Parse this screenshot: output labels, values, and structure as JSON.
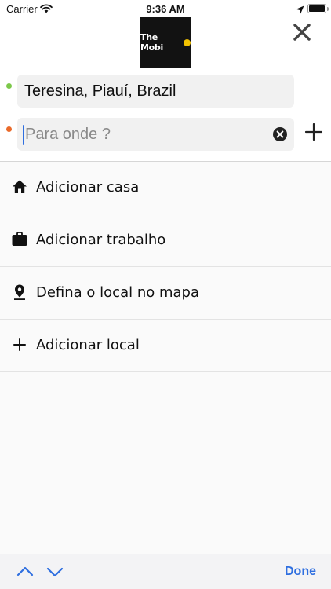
{
  "status_bar": {
    "carrier": "Carrier",
    "time": "9:36 AM",
    "battery_level": 1.0
  },
  "header": {
    "logo_text": "The Mobi"
  },
  "route": {
    "origin": "Teresina, Piauí, Brazil",
    "destination": {
      "value": "",
      "placeholder": "Para onde ?"
    },
    "start_color": "#7cc84a",
    "end_color": "#ea6a2a"
  },
  "places": [
    {
      "label": "Adicionar casa",
      "icon": "home-icon"
    },
    {
      "label": "Adicionar trabalho",
      "icon": "briefcase-icon"
    },
    {
      "label": "Defina o local no mapa",
      "icon": "map-pin-icon"
    },
    {
      "label": "Adicionar local",
      "icon": "plus-icon"
    }
  ],
  "keyboard_toolbar": {
    "done_label": "Done",
    "accent_color": "#2f6fe0"
  }
}
